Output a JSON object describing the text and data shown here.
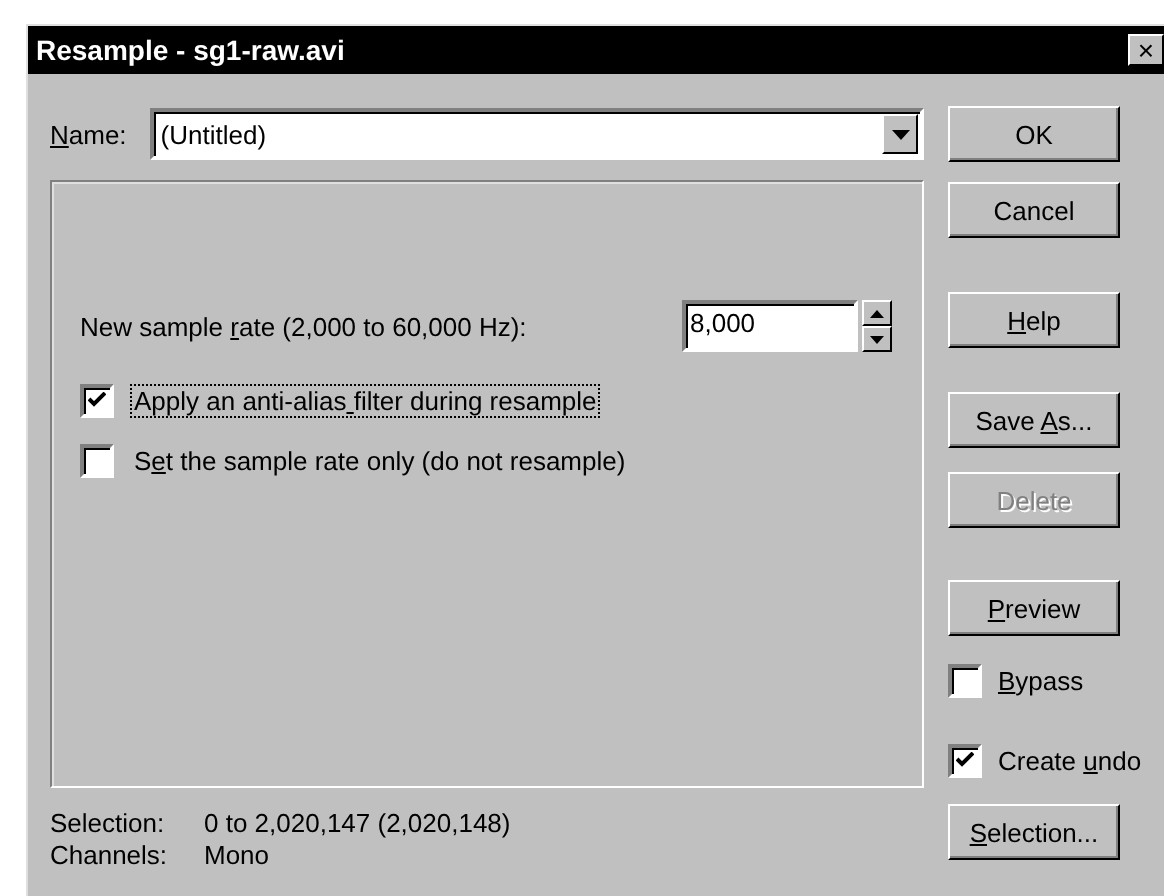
{
  "window": {
    "title": "Resample - sg1-raw.avi",
    "close": "×"
  },
  "name_field": {
    "label": "Name:",
    "value": "(Untitled)"
  },
  "sample_rate": {
    "label": "New sample rate (2,000 to 60,000 Hz):",
    "value": "8,000"
  },
  "options": [
    {
      "label": "Apply an anti-alias filter during resample",
      "checked": true,
      "focused": true
    },
    {
      "label": "Set the sample rate only (do not resample)",
      "checked": false,
      "focused": false
    }
  ],
  "side": [
    {
      "kind": "button",
      "label": "OK",
      "disabled": false
    },
    {
      "kind": "button",
      "label": "Cancel",
      "disabled": false
    },
    {
      "kind": "button",
      "label": "Help",
      "disabled": false
    },
    {
      "kind": "button",
      "label": "Save As...",
      "disabled": false
    },
    {
      "kind": "button",
      "label": "Delete",
      "disabled": true
    },
    {
      "kind": "button",
      "label": "Preview",
      "disabled": false
    },
    {
      "kind": "checkbox",
      "label": "Bypass",
      "checked": false
    },
    {
      "kind": "checkbox",
      "label": "Create undo",
      "checked": true
    },
    {
      "kind": "button",
      "label": "Selection...",
      "disabled": false
    }
  ],
  "info": [
    {
      "label": "Selection:",
      "value": "0 to 2,020,147 (2,020,148)"
    },
    {
      "label": "Channels:",
      "value": "Mono"
    }
  ]
}
